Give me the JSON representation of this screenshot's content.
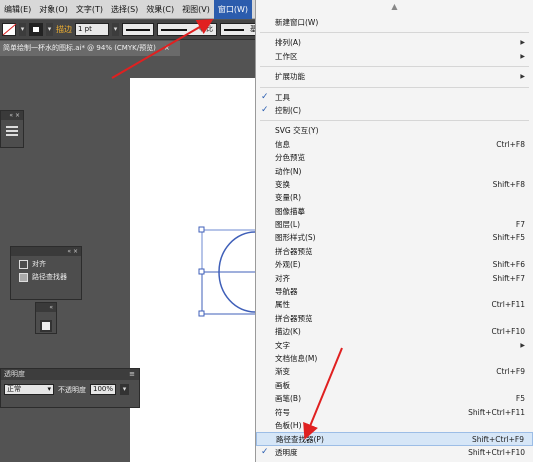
{
  "menubar": {
    "items": [
      {
        "label": "编辑(E)",
        "active": false
      },
      {
        "label": "对象(O)",
        "active": false
      },
      {
        "label": "文字(T)",
        "active": false
      },
      {
        "label": "选择(S)",
        "active": false
      },
      {
        "label": "效果(C)",
        "active": false
      },
      {
        "label": "视图(V)",
        "active": false
      },
      {
        "label": "窗口(W)",
        "active": true
      }
    ]
  },
  "controlbar": {
    "stroke_label": "描边",
    "stroke_weight": "1 pt",
    "profile_label": "等比",
    "brush_label": "基"
  },
  "document_tab": {
    "title": "简单绘制一杯水的图标.ai* @ 94% (CMYK/预览)",
    "close": "×"
  },
  "panels": {
    "align_panel": {
      "items": [
        {
          "label": "对齐",
          "icon": "align-icon"
        },
        {
          "label": "路径查找器",
          "icon": "pathfinder-icon"
        }
      ]
    },
    "transparency": {
      "title": "透明度",
      "blend_mode": "正常",
      "opacity_label": "不透明度",
      "opacity_value": "100%"
    }
  },
  "window_menu": {
    "groups": [
      [
        {
          "label": "新建窗口(W)",
          "shortcut": "",
          "checked": false,
          "submenu": false
        }
      ],
      [
        {
          "label": "排列(A)",
          "shortcut": "",
          "checked": false,
          "submenu": true
        },
        {
          "label": "工作区",
          "shortcut": "",
          "checked": false,
          "submenu": true
        }
      ],
      [
        {
          "label": "扩展功能",
          "shortcut": "",
          "checked": false,
          "submenu": true
        }
      ],
      [
        {
          "label": "工具",
          "shortcut": "",
          "checked": true,
          "submenu": false
        },
        {
          "label": "控制(C)",
          "shortcut": "",
          "checked": true,
          "submenu": false
        }
      ],
      [
        {
          "label": "SVG 交互(Y)",
          "shortcut": "",
          "checked": false,
          "submenu": false
        },
        {
          "label": "信息",
          "shortcut": "Ctrl+F8",
          "checked": false,
          "submenu": false
        },
        {
          "label": "分色预览",
          "shortcut": "",
          "checked": false,
          "submenu": false
        },
        {
          "label": "动作(N)",
          "shortcut": "",
          "checked": false,
          "submenu": false
        },
        {
          "label": "变换",
          "shortcut": "Shift+F8",
          "checked": false,
          "submenu": false
        },
        {
          "label": "变量(R)",
          "shortcut": "",
          "checked": false,
          "submenu": false
        },
        {
          "label": "图像描摹",
          "shortcut": "",
          "checked": false,
          "submenu": false
        },
        {
          "label": "图层(L)",
          "shortcut": "F7",
          "checked": false,
          "submenu": false
        },
        {
          "label": "图形样式(S)",
          "shortcut": "Shift+F5",
          "checked": false,
          "submenu": false
        },
        {
          "label": "拼合器预览",
          "shortcut": "",
          "checked": false,
          "submenu": false
        },
        {
          "label": "外观(E)",
          "shortcut": "Shift+F6",
          "checked": false,
          "submenu": false
        },
        {
          "label": "对齐",
          "shortcut": "Shift+F7",
          "checked": false,
          "submenu": false
        },
        {
          "label": "导航器",
          "shortcut": "",
          "checked": false,
          "submenu": false
        },
        {
          "label": "属性",
          "shortcut": "Ctrl+F11",
          "checked": false,
          "submenu": false
        },
        {
          "label": "拼合器预览",
          "shortcut": "",
          "checked": false,
          "submenu": false
        },
        {
          "label": "描边(K)",
          "shortcut": "Ctrl+F10",
          "checked": false,
          "submenu": false
        },
        {
          "label": "文字",
          "shortcut": "",
          "checked": false,
          "submenu": true
        },
        {
          "label": "文档信息(M)",
          "shortcut": "",
          "checked": false,
          "submenu": false
        },
        {
          "label": "渐变",
          "shortcut": "Ctrl+F9",
          "checked": false,
          "submenu": false
        },
        {
          "label": "画板",
          "shortcut": "",
          "checked": false,
          "submenu": false
        },
        {
          "label": "画笔(B)",
          "shortcut": "F5",
          "checked": false,
          "submenu": false
        },
        {
          "label": "符号",
          "shortcut": "Shift+Ctrl+F11",
          "checked": false,
          "submenu": false
        },
        {
          "label": "色板(H)",
          "shortcut": "",
          "checked": false,
          "submenu": false
        },
        {
          "label": "路径查找器(P)",
          "shortcut": "Shift+Ctrl+F9",
          "checked": false,
          "submenu": false,
          "highlight": true
        },
        {
          "label": "透明度",
          "shortcut": "Shift+Ctrl+F10",
          "checked": true,
          "submenu": false
        }
      ]
    ]
  },
  "colors": {
    "annotation_arrow": "#e02020",
    "menu_highlight": "#d6e6f7",
    "check_mark": "#2a5db0"
  }
}
